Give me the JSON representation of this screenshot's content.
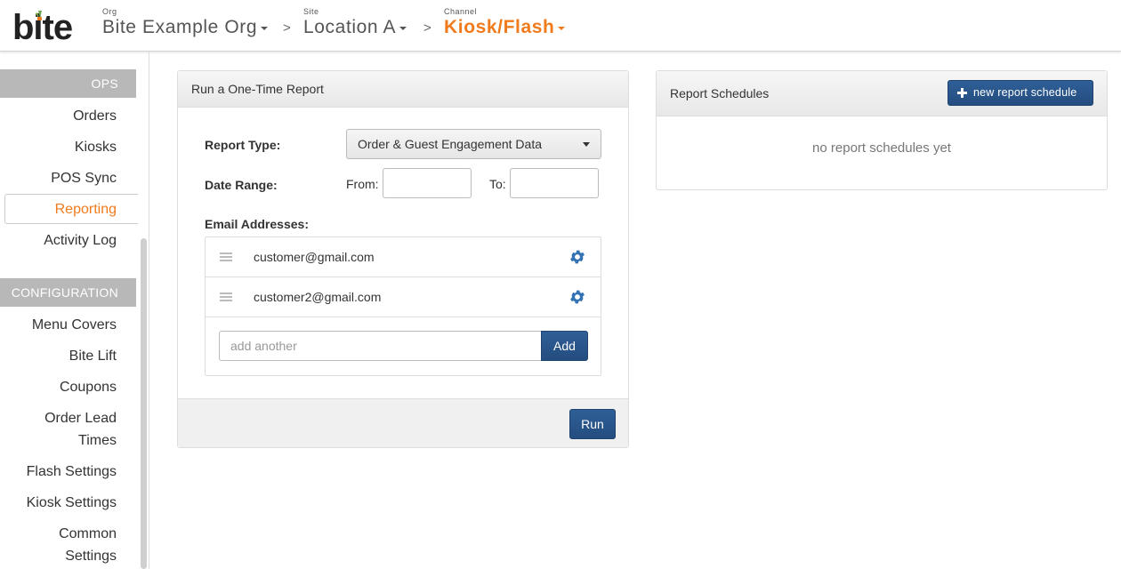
{
  "header": {
    "logo_text": "bite",
    "org": {
      "label": "Org",
      "value": "Bite Example Org"
    },
    "site": {
      "label": "Site",
      "value": "Location A"
    },
    "channel": {
      "label": "Channel",
      "value": "Kiosk/Flash"
    },
    "separator": ">"
  },
  "sidebar": {
    "ops_heading": "OPS",
    "ops_items": [
      {
        "label": "Orders"
      },
      {
        "label": "Kiosks"
      },
      {
        "label": "POS Sync"
      },
      {
        "label": "Reporting",
        "active": true
      },
      {
        "label": "Activity Log"
      }
    ],
    "config_heading": "CONFIGURATION",
    "config_items": [
      {
        "label": "Menu Covers"
      },
      {
        "label": "Bite Lift"
      },
      {
        "label": "Coupons"
      },
      {
        "label_line1": "Order Lead",
        "label_line2": "Times"
      },
      {
        "label": "Flash Settings"
      },
      {
        "label": "Kiosk Settings"
      },
      {
        "label_line1": "Common",
        "label_line2": "Settings"
      }
    ]
  },
  "report_panel": {
    "title": "Run a One-Time Report",
    "report_type_label": "Report Type:",
    "report_type_value": "Order & Guest Engagement Data",
    "date_range_label": "Date Range:",
    "from_label": "From:",
    "from_value": "",
    "to_label": "To:",
    "to_value": "",
    "emails_label": "Email Addresses:",
    "emails": [
      "customer@gmail.com",
      "customer2@gmail.com"
    ],
    "add_placeholder": "add another",
    "add_button": "Add",
    "run_button": "Run"
  },
  "schedules_panel": {
    "title": "Report Schedules",
    "new_button": "new report schedule",
    "empty_text": "no report schedules yet"
  },
  "colors": {
    "accent_orange": "#f07b1d",
    "primary_blue": "#2a5689",
    "gear_blue": "#3373b4",
    "sidebar_heading": "#b8b8b8"
  }
}
